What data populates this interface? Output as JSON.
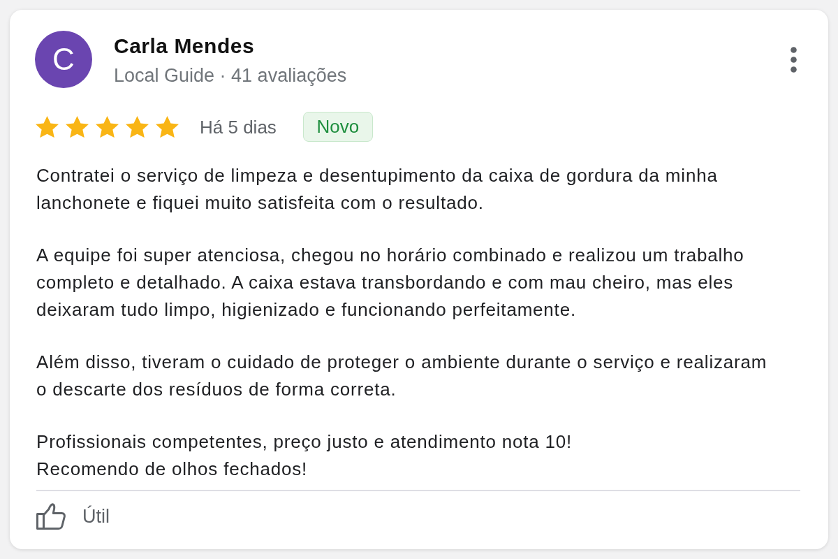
{
  "review": {
    "author": {
      "initial": "C",
      "name": "Carla Mendes",
      "info": "Local Guide · 41 avaliações"
    },
    "stars": 5,
    "date": "Há 5 dias",
    "tag": "Novo",
    "paragraphs": [
      "Contratei o serviço de limpeza e desentupimento da caixa de gordura da minha\nlanchonete e fiquei muito satisfeita com o resultado.",
      "A equipe foi super atenciosa, chegou no horário combinado e realizou um trabalho\ncompleto e detalhado. A caixa estava transbordando e com mau cheiro, mas eles\ndeixaram tudo limpo, higienizado e funcionando perfeitamente.",
      "Além disso, tiveram o cuidado de proteger o ambiente durante o serviço e realizaram\no descarte dos resíduos de forma correta.",
      "Profissionais competentes, preço justo e atendimento nota 10!\nRecomendo de olhos fechados!"
    ],
    "helpful_button": {
      "label": "Útil"
    }
  }
}
